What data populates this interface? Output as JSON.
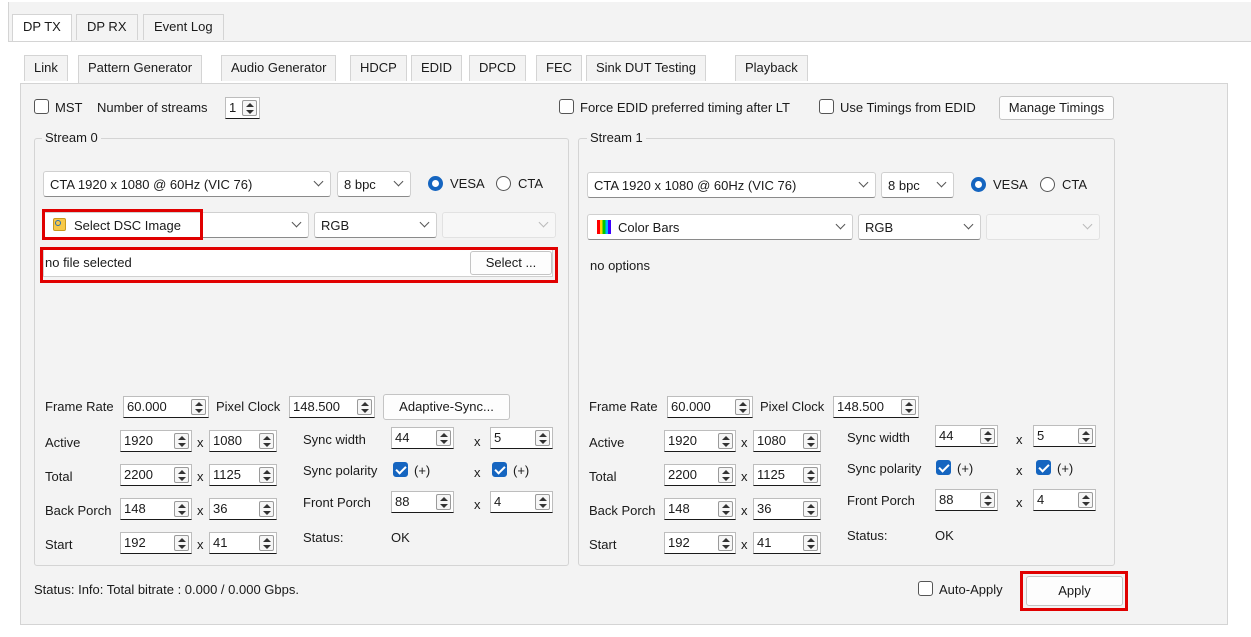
{
  "top_tabs": [
    "DP TX",
    "DP RX",
    "Event Log"
  ],
  "sub_tabs": [
    "Link",
    "Pattern Generator",
    "Audio Generator",
    "HDCP",
    "EDID",
    "DPCD",
    "FEC",
    "Sink DUT Testing",
    "Playback"
  ],
  "controls": {
    "mst_label": "MST",
    "num_streams_label": "Number of streams",
    "num_streams_value": "1",
    "force_edid_label": "Force EDID preferred timing after LT",
    "use_timings_label": "Use Timings from EDID",
    "manage_timings_label": "Manage Timings"
  },
  "stream0": {
    "title": "Stream 0",
    "timing": "CTA 1920 x 1080 @ 60Hz (VIC 76)",
    "bpc": "8 bpc",
    "vesa": "VESA",
    "cta": "CTA",
    "pattern": "Select DSC Image",
    "color_format": "RGB",
    "file_text": "no file selected",
    "select_button": "Select ...",
    "frame_rate_label": "Frame Rate",
    "frame_rate": "60.000",
    "pixel_clock_label": "Pixel Clock",
    "pixel_clock": "148.500",
    "adaptive_sync": "Adaptive-Sync...",
    "active_label": "Active",
    "active_h": "1920",
    "active_v": "1080",
    "total_label": "Total",
    "total_h": "2200",
    "total_v": "1125",
    "back_porch_label": "Back Porch",
    "back_porch_h": "148",
    "back_porch_v": "36",
    "start_label": "Start",
    "start_h": "192",
    "start_v": "41",
    "sync_width_label": "Sync width",
    "sync_width_h": "44",
    "sync_width_v": "5",
    "sync_polarity_label": "Sync polarity",
    "polarity_h": "(+)",
    "polarity_v": "(+)",
    "front_porch_label": "Front Porch",
    "front_porch_h": "88",
    "front_porch_v": "4",
    "status_label": "Status:",
    "status_value": "OK",
    "x": "x"
  },
  "stream1": {
    "title": "Stream 1",
    "timing": "CTA 1920 x 1080 @ 60Hz (VIC 76)",
    "bpc": "8 bpc",
    "vesa": "VESA",
    "cta": "CTA",
    "pattern": "Color Bars",
    "color_format": "RGB",
    "options_text": "no options",
    "frame_rate_label": "Frame Rate",
    "frame_rate": "60.000",
    "pixel_clock_label": "Pixel Clock",
    "pixel_clock": "148.500",
    "active_label": "Active",
    "active_h": "1920",
    "active_v": "1080",
    "total_label": "Total",
    "total_h": "2200",
    "total_v": "1125",
    "back_porch_label": "Back Porch",
    "back_porch_h": "148",
    "back_porch_v": "36",
    "start_label": "Start",
    "start_h": "192",
    "start_v": "41",
    "sync_width_label": "Sync width",
    "sync_width_h": "44",
    "sync_width_v": "5",
    "sync_polarity_label": "Sync polarity",
    "polarity_h": "(+)",
    "polarity_v": "(+)",
    "front_porch_label": "Front Porch",
    "front_porch_h": "88",
    "front_porch_v": "4",
    "status_label": "Status:",
    "status_value": "OK",
    "x": "x"
  },
  "footer": {
    "status": "Status:  Info: Total bitrate : 0.000 / 0.000 Gbps.",
    "auto_apply": "Auto-Apply",
    "apply": "Apply"
  },
  "colors": {
    "accent": "#1565c0",
    "highlight": "#e00000"
  },
  "icons": [
    "image-search-icon",
    "color-bars-icon"
  ]
}
